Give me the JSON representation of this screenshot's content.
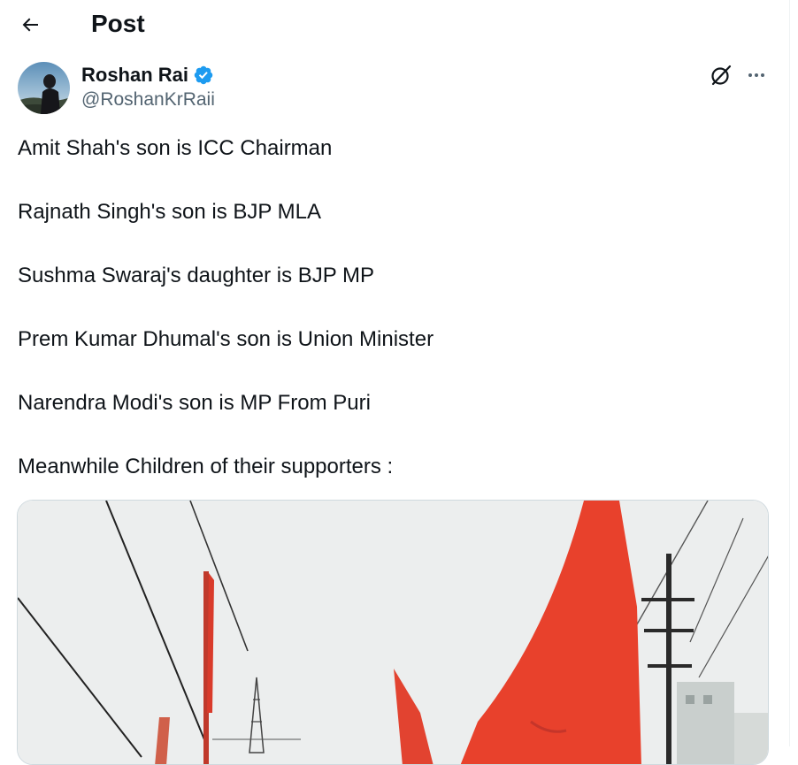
{
  "header": {
    "title": "Post",
    "back_icon": "arrow-left-icon"
  },
  "author": {
    "name": "Roshan Rai",
    "handle": "@RoshanKrRaii",
    "verified": true,
    "verified_color": "#1d9bf0"
  },
  "actions": {
    "grok_icon": "grok-icon",
    "more_icon": "more-horizontal-icon"
  },
  "post": {
    "lines": [
      "Amit Shah's son is ICC Chairman",
      "Rajnath Singh's son is BJP MLA",
      "Sushma Swaraj's daughter is BJP MP",
      "Prem Kumar Dhumal's son is Union Minister",
      "Narendra Modi's son is MP From Puri",
      "Meanwhile Children of their supporters :"
    ]
  },
  "media": {
    "type": "video",
    "description_colors": {
      "sky": "#eceeee",
      "flag": "#e8412c"
    }
  },
  "colors": {
    "text_primary": "#0f1419",
    "text_secondary": "#536471",
    "border": "#eff3f4"
  }
}
